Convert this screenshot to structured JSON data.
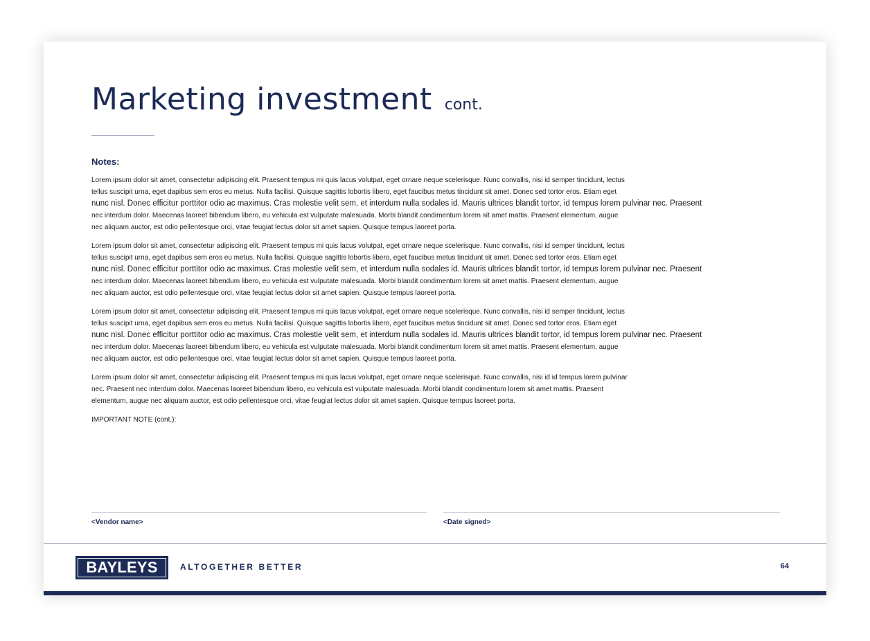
{
  "header": {
    "title": "Marketing investment",
    "subtitle": "cont."
  },
  "notes": {
    "heading": "Notes:",
    "paragraphs": [
      {
        "lines": [
          "Lorem ipsum dolor sit amet, consectetur adipiscing elit. Praesent tempus mi quis lacus volutpat, eget ornare neque scelerisque. Nunc convallis, nisi id semper tincidunt, lectus",
          "tellus suscipit urna, eget dapibus sem eros eu metus. Nulla facilisi. Quisque sagittis lobortis libero, eget faucibus metus tincidunt sit amet. Donec sed tortor eros. Etiam eget",
          "nunc nisl. Donec efficitur porttitor odio ac maximus. Cras molestie velit sem, et interdum nulla sodales id. Mauris ultrices blandit tortor, id tempus lorem pulvinar nec. Praesent",
          "nec interdum dolor. Maecenas laoreet bibendum libero, eu vehicula est vulputate malesuada. Morbi blandit condimentum lorem sit amet mattis. Praesent elementum, augue",
          "nec aliquam auctor, est odio pellentesque orci, vitae feugiat lectus dolor sit amet sapien. Quisque tempus laoreet porta."
        ]
      },
      {
        "lines": [
          "Lorem ipsum dolor sit amet, consectetur adipiscing elit. Praesent tempus mi quis lacus volutpat, eget ornare neque scelerisque. Nunc convallis, nisi id semper tincidunt, lectus",
          "tellus suscipit urna, eget dapibus sem eros eu metus. Nulla facilisi. Quisque sagittis lobortis libero, eget faucibus metus tincidunt sit amet. Donec sed tortor eros. Etiam eget",
          "nunc nisl. Donec efficitur porttitor odio ac maximus. Cras molestie velit sem, et interdum nulla sodales id. Mauris ultrices blandit tortor, id tempus lorem pulvinar nec. Praesent",
          "nec interdum dolor. Maecenas laoreet bibendum libero, eu vehicula est vulputate malesuada. Morbi blandit condimentum lorem sit amet mattis. Praesent elementum, augue",
          "nec aliquam auctor, est odio pellentesque orci, vitae feugiat lectus dolor sit amet sapien. Quisque tempus laoreet porta."
        ]
      },
      {
        "lines": [
          "Lorem ipsum dolor sit amet, consectetur adipiscing elit. Praesent tempus mi quis lacus volutpat, eget ornare neque scelerisque. Nunc convallis, nisi id semper tincidunt, lectus",
          "tellus suscipit urna, eget dapibus sem eros eu metus. Nulla facilisi. Quisque sagittis lobortis libero, eget faucibus metus tincidunt sit amet. Donec sed tortor eros. Etiam eget",
          "nunc nisl. Donec efficitur porttitor odio ac maximus. Cras molestie velit sem, et interdum nulla sodales id. Mauris ultrices blandit tortor, id tempus lorem pulvinar nec. Praesent",
          "nec interdum dolor. Maecenas laoreet bibendum libero, eu vehicula est vulputate malesuada. Morbi blandit condimentum lorem sit amet mattis. Praesent elementum, augue",
          "nec aliquam auctor, est odio pellentesque orci, vitae feugiat lectus dolor sit amet sapien. Quisque tempus laoreet porta."
        ]
      },
      {
        "lines": [
          "Lorem ipsum dolor sit amet, consectetur adipiscing elit. Praesent tempus mi quis lacus volutpat, eget ornare neque scelerisque. Nunc convallis, nisi id id tempus lorem pulvinar",
          "nec. Praesent nec interdum dolor. Maecenas laoreet bibendum libero, eu vehicula est vulputate malesuada. Morbi blandit condimentum lorem sit amet mattis. Praesent",
          "elementum, augue nec aliquam auctor, est odio pellentesque orci, vitae feugiat lectus dolor sit amet sapien. Quisque tempus laoreet porta."
        ]
      }
    ],
    "important_note": "IMPORTANT NOTE (cont.):"
  },
  "signature": {
    "vendor_label": "<Vendor name>",
    "date_label": "<Date signed>"
  },
  "footer": {
    "logo_text": "BAYLEYS",
    "tagline": "ALTOGETHER BETTER",
    "page_number": "64"
  },
  "colors": {
    "brand_navy": "#1c2a56",
    "rule_gray": "#9ba2b4"
  }
}
